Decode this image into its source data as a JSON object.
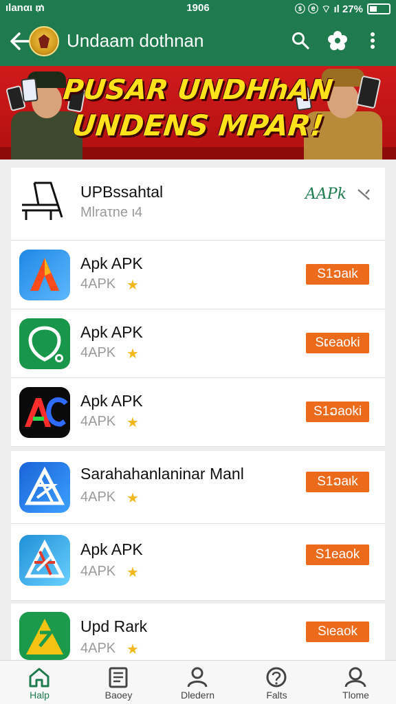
{
  "status_bar": {
    "left": "ılanαι ₥",
    "time": "1906",
    "right": "ⓢ ⓔ ⌔ ıl 27%"
  },
  "app_bar": {
    "title": "Undaam dothnan"
  },
  "banner": {
    "line1": "PUSAR UNDHhAN",
    "line2": "UNDENS MPAR!"
  },
  "featured": {
    "title": "UPBssahtal",
    "subtitle": "Mlraτne ι4",
    "badge": "AAPk"
  },
  "apps": [
    {
      "title": "Apk APK",
      "sub": "4APK",
      "button": "S1ວaιk",
      "icon": "red-a-icon"
    },
    {
      "title": "Apk APK",
      "sub": "4APK",
      "button": "Sເeaoki",
      "icon": "green-shield-icon"
    },
    {
      "title": "Apk APK",
      "sub": "4APK",
      "button": "S1ວaοki",
      "icon": "ac-logo-icon"
    },
    {
      "title": "Sarahahanlaninar Manl",
      "sub": "4APK",
      "button": "S1ວaιk",
      "icon": "blue-triangle-icon"
    },
    {
      "title": "Apk APK",
      "sub": "4APK",
      "button": "S1eaok",
      "icon": "teal-triangle-icon"
    },
    {
      "title": "Upd Rark",
      "sub": "4APK",
      "button": "Sιeaok",
      "icon": "yellow-triangle-icon"
    }
  ],
  "bottom_nav": [
    {
      "label": "Halp",
      "icon": "home-icon",
      "active": true
    },
    {
      "label": "Baoey",
      "icon": "book-icon",
      "active": false
    },
    {
      "label": "Dledern",
      "icon": "person-icon",
      "active": false
    },
    {
      "label": "Falts",
      "icon": "help-circle-icon",
      "active": false
    },
    {
      "label": "Tlome",
      "icon": "profile-icon",
      "active": false
    }
  ],
  "colors": {
    "primary": "#1f7a4e",
    "banner_red": "#c8161a",
    "banner_text": "#ffe21a",
    "button_orange": "#ec6a1c",
    "star": "#f2b81d"
  }
}
